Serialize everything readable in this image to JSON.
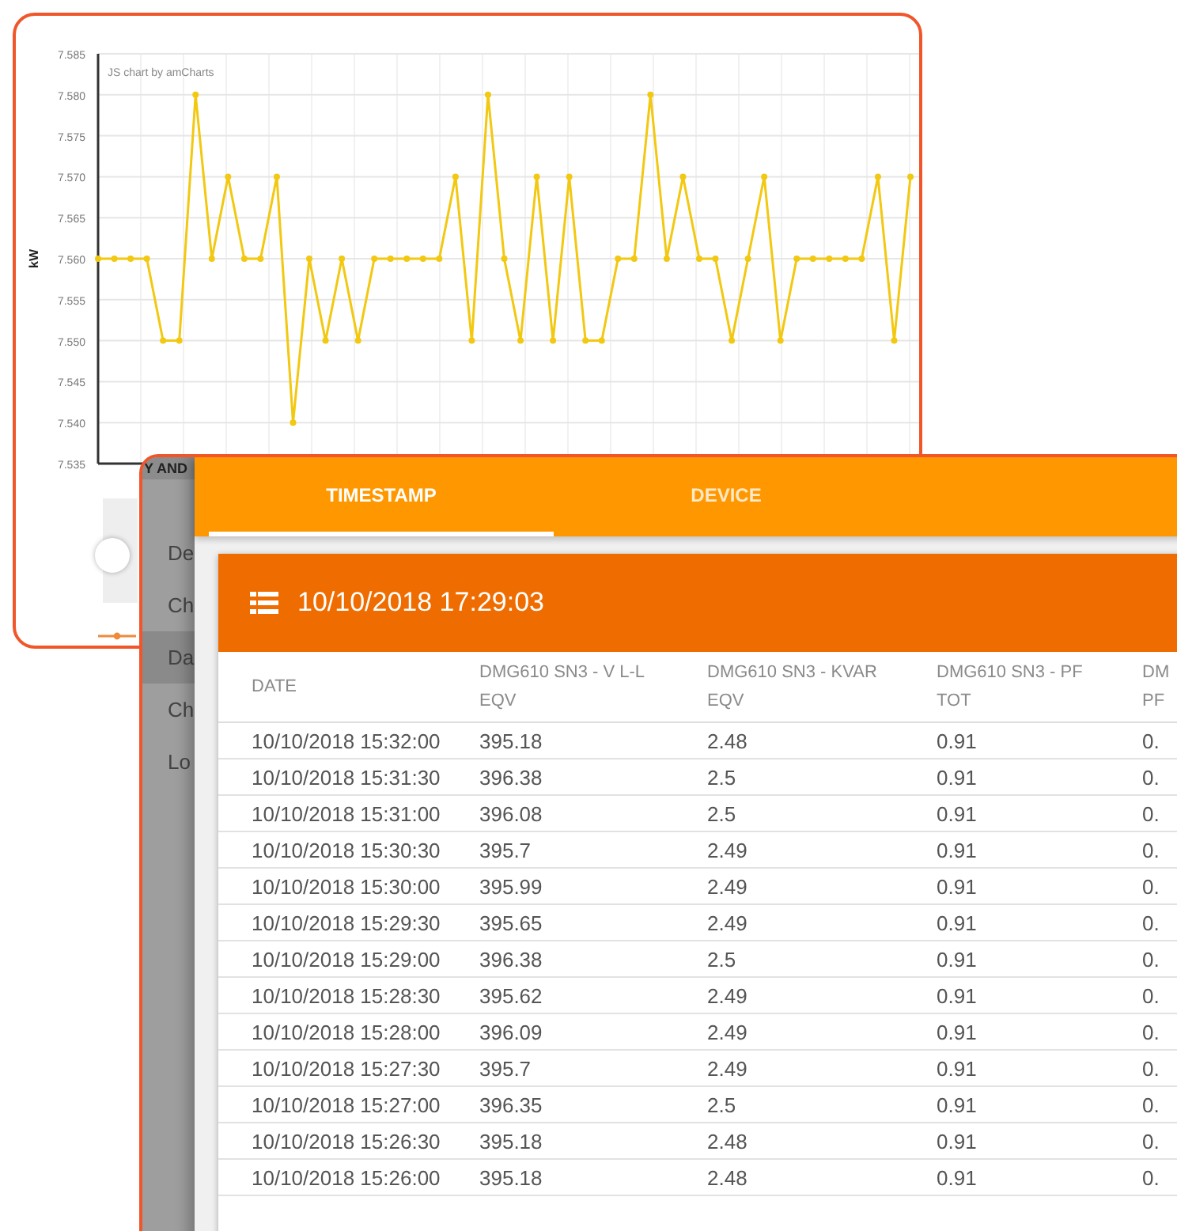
{
  "chart_card": {
    "credit": "JS chart by amCharts",
    "chart_data": {
      "type": "line",
      "ylabel": "kW",
      "grid": true,
      "ylim": [
        7.535,
        7.585
      ],
      "yticks": [
        {
          "value": 7.535,
          "label": "7.535"
        },
        {
          "value": 7.54,
          "label": "7.540"
        },
        {
          "value": 7.545,
          "label": "7.545"
        },
        {
          "value": 7.55,
          "label": "7.550"
        },
        {
          "value": 7.555,
          "label": "7.555"
        },
        {
          "value": 7.56,
          "label": "7.560"
        },
        {
          "value": 7.565,
          "label": "7.565"
        },
        {
          "value": 7.57,
          "label": "7.570"
        },
        {
          "value": 7.575,
          "label": "7.575"
        },
        {
          "value": 7.58,
          "label": "7.580"
        },
        {
          "value": 7.585,
          "label": "7.585"
        }
      ],
      "series": [
        {
          "color": "#f2c811",
          "marker": true,
          "values": [
            7.56,
            7.56,
            7.56,
            7.56,
            7.55,
            7.55,
            7.58,
            7.56,
            7.57,
            7.56,
            7.56,
            7.57,
            7.54,
            7.56,
            7.55,
            7.56,
            7.55,
            7.56,
            7.56,
            7.56,
            7.56,
            7.56,
            7.57,
            7.55,
            7.58,
            7.56,
            7.55,
            7.57,
            7.55,
            7.57,
            7.55,
            7.55,
            7.56,
            7.56,
            7.58,
            7.56,
            7.57,
            7.56,
            7.56,
            7.55,
            7.56,
            7.57,
            7.55,
            7.56,
            7.56,
            7.56,
            7.56,
            7.56,
            7.57,
            7.55,
            7.57
          ]
        }
      ]
    }
  },
  "app": {
    "sidebar": {
      "header": "Y AND",
      "items": [
        {
          "label": "De",
          "selected": false
        },
        {
          "label": "Ch",
          "selected": false
        },
        {
          "label": "Da",
          "selected": true
        },
        {
          "label": "Ch",
          "selected": false
        },
        {
          "label": "Lo",
          "selected": false
        }
      ]
    },
    "tabs": [
      {
        "label": "TIMESTAMP",
        "selected": true
      },
      {
        "label": "DEVICE",
        "selected": false
      }
    ],
    "card": {
      "title": "10/10/2018 17:29:03"
    },
    "table": {
      "columns": [
        "DATE",
        "DMG610 SN3 - V L-L EQV",
        "DMG610 SN3 - KVAR EQV",
        "DMG610 SN3 - PF TOT",
        "DM PF"
      ],
      "rows": [
        [
          "10/10/2018 15:32:00",
          "395.18",
          "2.48",
          "0.91",
          "0."
        ],
        [
          "10/10/2018 15:31:30",
          "396.38",
          "2.5",
          "0.91",
          "0."
        ],
        [
          "10/10/2018 15:31:00",
          "396.08",
          "2.5",
          "0.91",
          "0."
        ],
        [
          "10/10/2018 15:30:30",
          "395.7",
          "2.49",
          "0.91",
          "0."
        ],
        [
          "10/10/2018 15:30:00",
          "395.99",
          "2.49",
          "0.91",
          "0."
        ],
        [
          "10/10/2018 15:29:30",
          "395.65",
          "2.49",
          "0.91",
          "0."
        ],
        [
          "10/10/2018 15:29:00",
          "396.38",
          "2.5",
          "0.91",
          "0."
        ],
        [
          "10/10/2018 15:28:30",
          "395.62",
          "2.49",
          "0.91",
          "0."
        ],
        [
          "10/10/2018 15:28:00",
          "396.09",
          "2.49",
          "0.91",
          "0."
        ],
        [
          "10/10/2018 15:27:30",
          "395.7",
          "2.49",
          "0.91",
          "0."
        ],
        [
          "10/10/2018 15:27:00",
          "396.35",
          "2.5",
          "0.91",
          "0."
        ],
        [
          "10/10/2018 15:26:30",
          "395.18",
          "2.48",
          "0.91",
          "0."
        ],
        [
          "10/10/2018 15:26:00",
          "395.18",
          "2.48",
          "0.91",
          "0."
        ]
      ]
    }
  }
}
